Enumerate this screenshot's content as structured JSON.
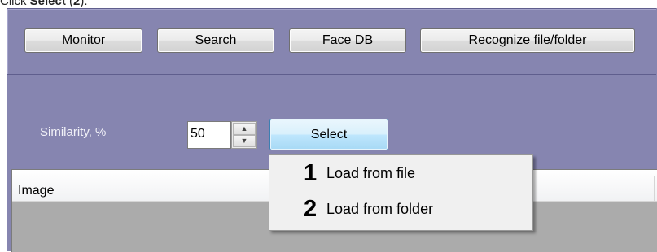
{
  "instruction": {
    "prefix": "Click ",
    "bold_word": "Select",
    "paren_open": " (",
    "bold_num": "2",
    "suffix": ")."
  },
  "toolbar": {
    "monitor_label": "Monitor",
    "search_label": "Search",
    "facedb_label": "Face DB",
    "recognize_label": "Recognize file/folder"
  },
  "similarity": {
    "label": "Similarity, %",
    "value": "50",
    "spin_up": "▲",
    "spin_down": "▼",
    "select_label": "Select"
  },
  "grid": {
    "columns": [
      "Image"
    ]
  },
  "context_menu": {
    "items": [
      {
        "number": "1",
        "label": "Load from file"
      },
      {
        "number": "2",
        "label": "Load from folder"
      }
    ]
  },
  "colors": {
    "panel_bg": "#8685b0",
    "select_highlight": "#bee6fd",
    "grid_bg": "#ababab"
  }
}
